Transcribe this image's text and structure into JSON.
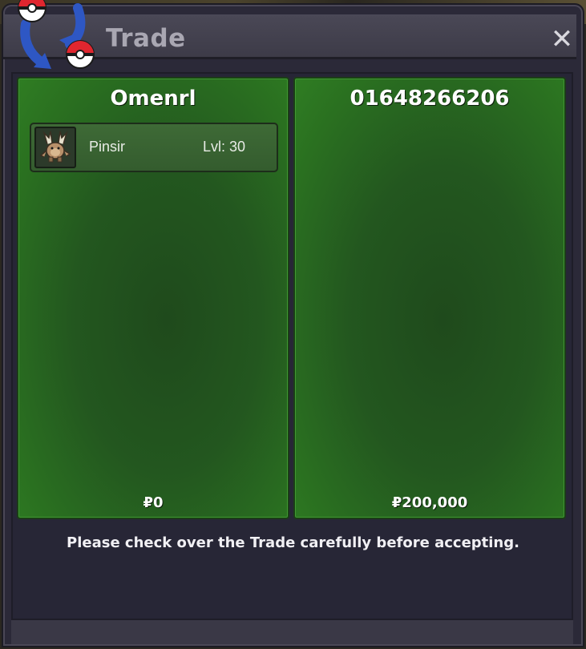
{
  "window": {
    "title": "Trade",
    "close_symbol": "✕"
  },
  "left_panel": {
    "player_name": "Omenrl",
    "pokemon": [
      {
        "name": "Pinsir",
        "level": "Lvl: 30",
        "icon": "pinsir-sprite-icon"
      }
    ],
    "money": "0",
    "currency_symbol": "₽"
  },
  "right_panel": {
    "player_name": "01648266206",
    "pokemon": [],
    "money": "200,000",
    "currency_symbol": "₽"
  },
  "notice": "Please check over the Trade carefully before accepting.",
  "colors": {
    "panel_green": "#2a7020",
    "window_bg": "#2b2938",
    "title_text": "#a9a7b2"
  }
}
